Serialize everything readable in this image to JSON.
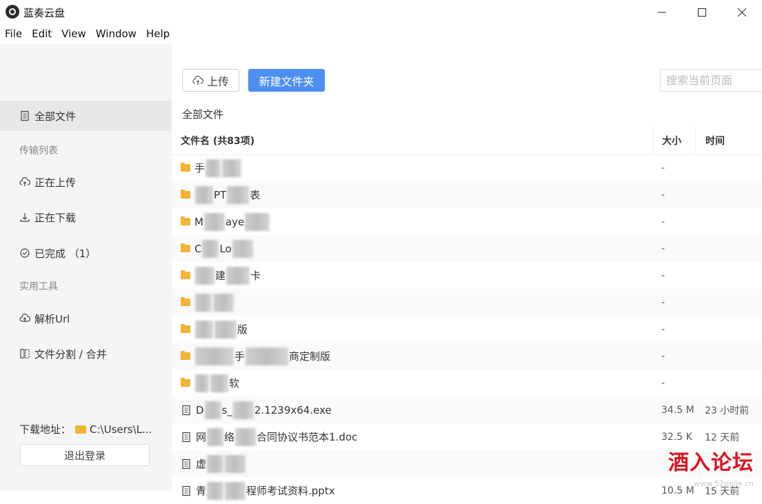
{
  "window": {
    "title": "蓝奏云盘"
  },
  "menu": [
    "File",
    "Edit",
    "View",
    "Window",
    "Help"
  ],
  "sidebar": {
    "all_files": "全部文件",
    "transfer_section": "传输列表",
    "uploading": "正在上传",
    "downloading": "正在下载",
    "completed": "已完成 （1）",
    "tools_section": "实用工具",
    "parse_url": "解析Url",
    "split_merge": "文件分割 / 合并",
    "download_path_label": "下载地址：",
    "download_path_value": "C:\\Users\\L...",
    "logout": "退出登录"
  },
  "toolbar": {
    "upload_label": "上传",
    "new_folder_label": "新建文件夹",
    "search_placeholder": "搜索当前页面"
  },
  "breadcrumb": "全部文件",
  "table": {
    "headers": {
      "name": "文件名 (共83项)",
      "size": "大小",
      "time": "时间"
    },
    "rows": [
      {
        "type": "folder",
        "name_parts": [
          "手",
          "",
          ""
        ],
        "size": "-",
        "time": ""
      },
      {
        "type": "folder",
        "name_parts": [
          "",
          "PT",
          "表"
        ],
        "size": "-",
        "time": ""
      },
      {
        "type": "folder",
        "name_parts": [
          "M",
          "aye",
          ""
        ],
        "size": "-",
        "time": ""
      },
      {
        "type": "folder",
        "name_parts": [
          "C",
          "Lo",
          ""
        ],
        "size": "-",
        "time": ""
      },
      {
        "type": "folder",
        "name_parts": [
          "",
          "建",
          "卡"
        ],
        "size": "-",
        "time": ""
      },
      {
        "type": "folder",
        "name_parts": [
          "",
          "",
          ""
        ],
        "size": "-",
        "time": ""
      },
      {
        "type": "folder",
        "name_parts": [
          "",
          "",
          "版"
        ],
        "size": "-",
        "time": ""
      },
      {
        "type": "folder",
        "name_parts": [
          "",
          "手",
          "商定制版"
        ],
        "size": "-",
        "time": ""
      },
      {
        "type": "folder",
        "name_parts": [
          "",
          "",
          "软"
        ],
        "size": "-",
        "time": ""
      },
      {
        "type": "file",
        "name_parts": [
          "D",
          "s_",
          "2.1239x64.exe"
        ],
        "size": "34.5 M",
        "time": "23 小时前"
      },
      {
        "type": "file",
        "name_parts": [
          "网",
          "络",
          "合同协议书范本1.doc"
        ],
        "size": "32.5 K",
        "time": "12 天前"
      },
      {
        "type": "file",
        "name_parts": [
          "虚",
          "",
          ""
        ],
        "size": "",
        "time": ""
      },
      {
        "type": "file",
        "name_parts": [
          "青",
          "",
          "程师考试资料.pptx"
        ],
        "size": "10.5 M",
        "time": "15 天前"
      }
    ]
  },
  "watermark": {
    "text": "酒入论坛",
    "sub": "www.52pojie.cn"
  }
}
